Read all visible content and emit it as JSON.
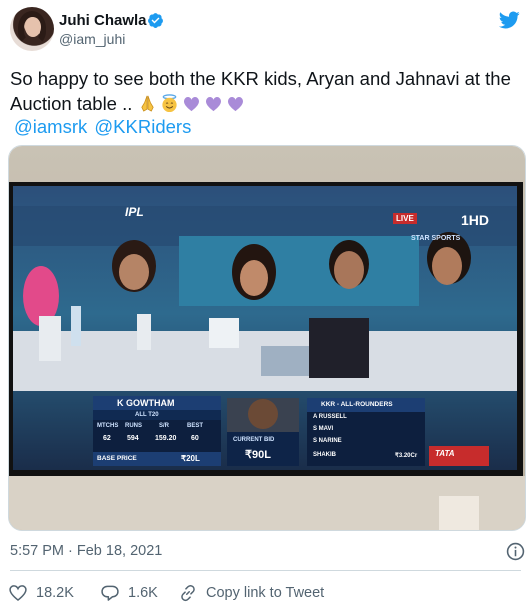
{
  "author": {
    "name": "Juhi Chawla",
    "handle": "@iam_juhi",
    "verified": true
  },
  "tweet": {
    "text": "So happy to see both the KKR kids, Aryan and Jahnavi at the Auction table .. ",
    "emojis": [
      "folded-hands",
      "smiling-face-with-halo",
      "purple-heart",
      "purple-heart",
      "purple-heart"
    ],
    "mentions": [
      "@iamsrk",
      "@KKRiders"
    ]
  },
  "media": {
    "tv_overlay": {
      "tournament_logo": "IPL",
      "live_badge": "LIVE",
      "channel": "1HD",
      "channel_sub": "STAR SPORTS",
      "player_name": "K GOWTHAM",
      "player_sub": "ALL T20",
      "stat_headers": [
        "MTCHS",
        "RUNS",
        "S/R",
        "BEST"
      ],
      "stat_values": [
        "62",
        "594",
        "159.20",
        "60"
      ],
      "base_price_label": "BASE PRICE",
      "base_price_value": "₹20L",
      "current_bid_label": "CURRENT BID",
      "current_bid_value": "₹90L",
      "team_panel_title": "KKR - ALL-ROUNDERS",
      "team_players": [
        "A RUSSELL",
        "S MAVI",
        "S NARINE",
        "SHAKIB"
      ],
      "team_last_price": "₹3.20Cr",
      "sponsor": "TATA"
    }
  },
  "meta": {
    "timestamp": "5:57 PM · Feb 18, 2021"
  },
  "actions": {
    "likes": "18.2K",
    "replies": "1.6K",
    "copy_link": "Copy link to Tweet"
  },
  "colors": {
    "link_blue": "#1d9bf0",
    "muted_gray": "#536471",
    "verified_blue": "#1d9bf0"
  }
}
